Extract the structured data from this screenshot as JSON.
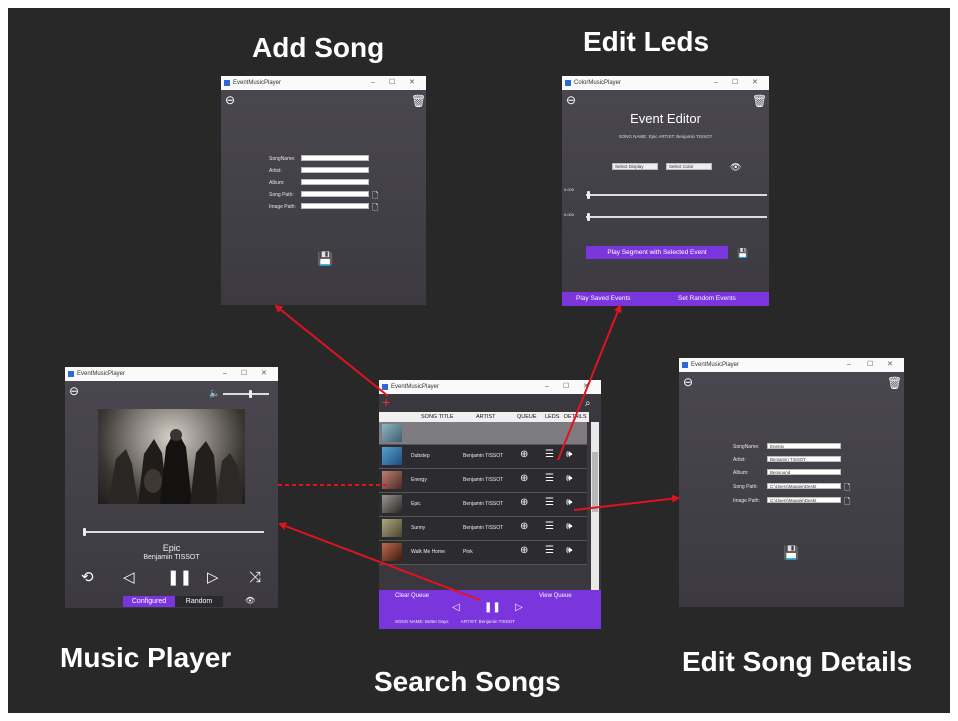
{
  "titles": {
    "add_song": "Add Song",
    "edit_leds": "Edit Leds",
    "music_player": "Music Player",
    "search_songs": "Search Songs",
    "edit_song_details": "Edit Song Details"
  },
  "windows": {
    "app_title": "EventMusicPlayer",
    "led_app_title": "ColorMusicPlayer",
    "minimize": "–",
    "maximize": "☐",
    "close": "✕"
  },
  "add_song": {
    "fields": [
      {
        "label": "SongName:",
        "value": ""
      },
      {
        "label": "Artist:",
        "value": ""
      },
      {
        "label": "Album:",
        "value": ""
      },
      {
        "label": "Song Path:",
        "value": ""
      },
      {
        "label": "Image Path:",
        "value": ""
      }
    ]
  },
  "edit_leds": {
    "heading": "Event Editor",
    "song_info": "SONG NAME: Epic     ARTIST: Benjamin TISSOT",
    "select_display": "Select Display",
    "select_color": "Select Color",
    "slider1_label": "0.000",
    "slider2_label": "0.000",
    "play_segment": "Play Segment with Selected Event",
    "play_saved": "Play Saved Events",
    "set_random": "Set Random Events"
  },
  "music_player": {
    "song_title": "Epic",
    "artist": "Benjamin TISSOT",
    "configured": "Configured",
    "random": "Random"
  },
  "search": {
    "headers": [
      "SONG TITLE",
      "ARTIST",
      "QUEUE",
      "LEDS",
      "DETAILS"
    ],
    "rows": [
      {
        "title": "Dubstep",
        "artist": "Benjamin TISSOT"
      },
      {
        "title": "Energy",
        "artist": "Benjamin TISSOT"
      },
      {
        "title": "Epic",
        "artist": "Benjamin TISSOT"
      },
      {
        "title": "Sunny",
        "artist": "Benjamin TISSOT"
      },
      {
        "title": "Walk Me Home",
        "artist": "Pink"
      }
    ],
    "clear_queue": "Clear Queue",
    "view_queue": "View Queue",
    "now_playing": "SONG NAME: Better Days          ARTIST: Benjamin TISSOT"
  },
  "edit_details": {
    "fields": [
      {
        "label": "SongName:",
        "value": "Energy"
      },
      {
        "label": "Artist:",
        "value": "Benjamin TISSOT"
      },
      {
        "label": "Album:",
        "value": "Bensound"
      },
      {
        "label": "Song Path:",
        "value": "C:\\Users\\Maggie\\Deskt"
      },
      {
        "label": "Image Path:",
        "value": "C:\\Users\\Maggie\\Deskt"
      }
    ]
  },
  "colors": {
    "accent": "#7b35dd",
    "arrow": "#e0141e",
    "background": "#282828"
  }
}
